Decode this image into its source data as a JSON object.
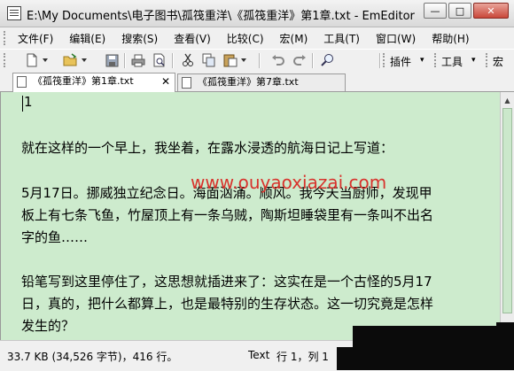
{
  "window": {
    "title": "E:\\My Documents\\电子图书\\孤筏重洋\\《孤筏重洋》第1章.txt - EmEditor",
    "minimize_glyph": "—",
    "maximize_glyph": "□",
    "close_glyph": "✕"
  },
  "menu": {
    "items": [
      "文件(F)",
      "编辑(E)",
      "搜索(S)",
      "查看(V)",
      "比较(C)",
      "宏(M)",
      "工具(T)",
      "窗口(W)",
      "帮助(H)"
    ]
  },
  "toolbar": {
    "plugins_label": "插件",
    "tools_label": "工具",
    "macro_label": "宏",
    "icons": [
      "new-file-icon",
      "open-folder-icon",
      "save-icon",
      "print-icon",
      "print-preview-icon",
      "cut-icon",
      "copy-icon",
      "paste-icon",
      "undo-icon",
      "redo-icon",
      "find-icon"
    ]
  },
  "tabs": [
    {
      "label": "《孤筏重洋》第1章.txt",
      "active": true,
      "close_glyph": "✕"
    },
    {
      "label": "《孤筏重洋》第7章.txt",
      "active": false
    }
  ],
  "editor": {
    "background_color": "#cdebcd",
    "lines": [
      "1",
      "就在这样的一个早上，我坐着，在露水浸透的航海日记上写道：",
      "5月17日。挪威独立纪念日。海面汹涌。顺风。我今天当厨师，发现甲",
      "板上有七条飞鱼，竹屋顶上有一条乌贼，陶斯坦睡袋里有一条叫不出名",
      "字的鱼……",
      "铅笔写到这里停住了，这思想就插进来了：这实在是一个古怪的5月17",
      "日，真的，把什么都算上，也是最特别的生存状态。这一切究竟是怎样",
      "发生的？"
    ],
    "watermark": "www.ouyaoxiazai.com"
  },
  "status": {
    "size": "33.7 KB (34,526 字节)，416 行。",
    "mode": "Text",
    "position": "行 1，列 1"
  },
  "colors": {
    "editor_bg": "#cdebcd",
    "watermark": "#d8322c",
    "close_button": "#c9473a"
  }
}
